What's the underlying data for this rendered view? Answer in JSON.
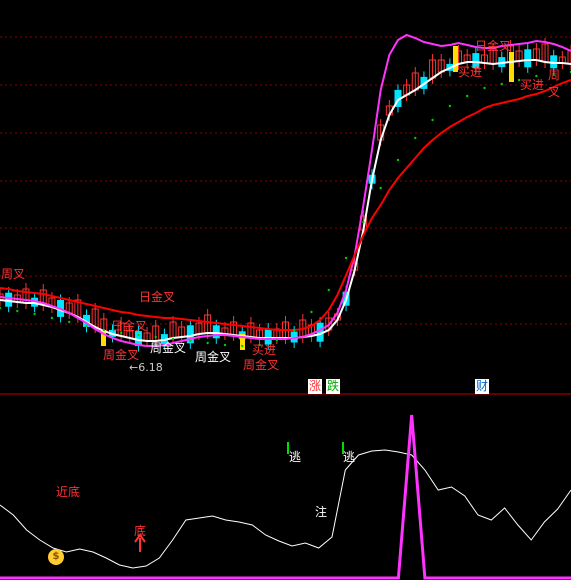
{
  "colors": {
    "background": "#000000",
    "grid": "#8b0000",
    "divider": "#c00000",
    "candle_up": "#ff3333",
    "candle_down": "#00e5ff",
    "short_ma": "#ffffff",
    "mid_ma": "#ff33ff",
    "long_ma": "#ff0000",
    "dots": "#00cc00",
    "highlight": "#ffdd00",
    "oscillator": "#ffffff",
    "spike": "#ff33ff",
    "green_bar": "#00dd00",
    "label_red": "#ff3333",
    "label_white": "#ffffff"
  },
  "chart_data": [
    {
      "type": "candlestick",
      "panel": "price",
      "series": [
        {
          "name": "",
          "role": "short_ma",
          "values": [
            300,
            301,
            302,
            303,
            303,
            305,
            307,
            310,
            313,
            317,
            322,
            327,
            331,
            334,
            336,
            338,
            340,
            341,
            341,
            340,
            338,
            337,
            336,
            334,
            333,
            333,
            334,
            335,
            336,
            337,
            338,
            338,
            338,
            338,
            338,
            337,
            336,
            334,
            330,
            320,
            300,
            270,
            230,
            180,
            140,
            115,
            100,
            95,
            90,
            84,
            78,
            72,
            68,
            64,
            62,
            62,
            63,
            64,
            63,
            62,
            61,
            60,
            60,
            62,
            63,
            63,
            64
          ]
        },
        {
          "name": "",
          "role": "mid_ma",
          "values": [
            297,
            298,
            299,
            300,
            301,
            303,
            306,
            309,
            313,
            318,
            323,
            329,
            334,
            338,
            341,
            343,
            345,
            346,
            346,
            345,
            343,
            341,
            339,
            337,
            336,
            335,
            335,
            336,
            337,
            338,
            339,
            339,
            339,
            339,
            338,
            337,
            334,
            330,
            325,
            313,
            290,
            255,
            205,
            150,
            90,
            55,
            40,
            35,
            38,
            42,
            44,
            46,
            45,
            43,
            45,
            47,
            48,
            48,
            46,
            45,
            44,
            43,
            41,
            42,
            44,
            47,
            51
          ]
        },
        {
          "name": "",
          "role": "long_ma",
          "values": [
            288,
            289,
            291,
            292,
            293,
            294,
            296,
            298,
            300,
            302,
            304,
            306,
            308,
            310,
            312,
            313,
            315,
            316,
            317,
            318,
            318,
            319,
            320,
            321,
            322,
            323,
            324,
            325,
            326,
            327,
            328,
            329,
            330,
            330,
            330,
            329,
            326,
            320,
            310,
            295,
            275,
            255,
            235,
            218,
            205,
            190,
            178,
            168,
            158,
            148,
            140,
            133,
            127,
            122,
            117,
            113,
            108,
            105,
            103,
            101,
            99,
            96,
            94,
            91,
            87,
            83,
            80
          ]
        },
        {
          "name": "",
          "role": "dots",
          "values": [
            308,
            309,
            311,
            312,
            314,
            316,
            318,
            320,
            322,
            324,
            326,
            328,
            330,
            332,
            333,
            334,
            335,
            336,
            337,
            338,
            339,
            340,
            341,
            342,
            343,
            344,
            345,
            345,
            346,
            346,
            345,
            343,
            340,
            336,
            330,
            322,
            312,
            300,
            290,
            275,
            258,
            240,
            222,
            205,
            188,
            172,
            160,
            148,
            138,
            128,
            120,
            112,
            106,
            100,
            96,
            92,
            88,
            86,
            84,
            82,
            80,
            78,
            76,
            75,
            74,
            73,
            72
          ]
        }
      ]
    },
    {
      "type": "line",
      "panel": "oscillator",
      "series": [
        {
          "name": "",
          "role": "oscillator",
          "values": [
            505,
            515,
            530,
            540,
            548,
            552,
            549,
            552,
            558,
            565,
            568,
            566,
            558,
            540,
            520,
            518,
            516,
            520,
            522,
            525,
            535,
            541,
            546,
            543,
            548,
            537,
            470,
            455,
            451,
            450,
            452,
            455,
            470,
            490,
            487,
            496,
            515,
            520,
            508,
            525,
            540,
            522,
            509,
            490
          ]
        },
        {
          "name": "",
          "role": "spike",
          "values": [
            578,
            578,
            578,
            578,
            578,
            578,
            578,
            578,
            578,
            578,
            578,
            578,
            578,
            578,
            578,
            578,
            578,
            578,
            578,
            578,
            578,
            578,
            578,
            578,
            578,
            578,
            578,
            578,
            578,
            578,
            578,
            415,
            578,
            578,
            578,
            578,
            578,
            578,
            578,
            578,
            578,
            578,
            578,
            578
          ]
        }
      ]
    }
  ],
  "labels": {
    "ri_jin_cha": "日金叉",
    "zhou_jin_cha": "周金叉",
    "mai_jin": "买进",
    "zhou_cha": "周叉",
    "zhang": "涨",
    "die": "跌",
    "cai": "财",
    "tao": "逃",
    "zhu": "注",
    "jin_di": "近底",
    "di": "底",
    "price_tag": "←6.18"
  }
}
